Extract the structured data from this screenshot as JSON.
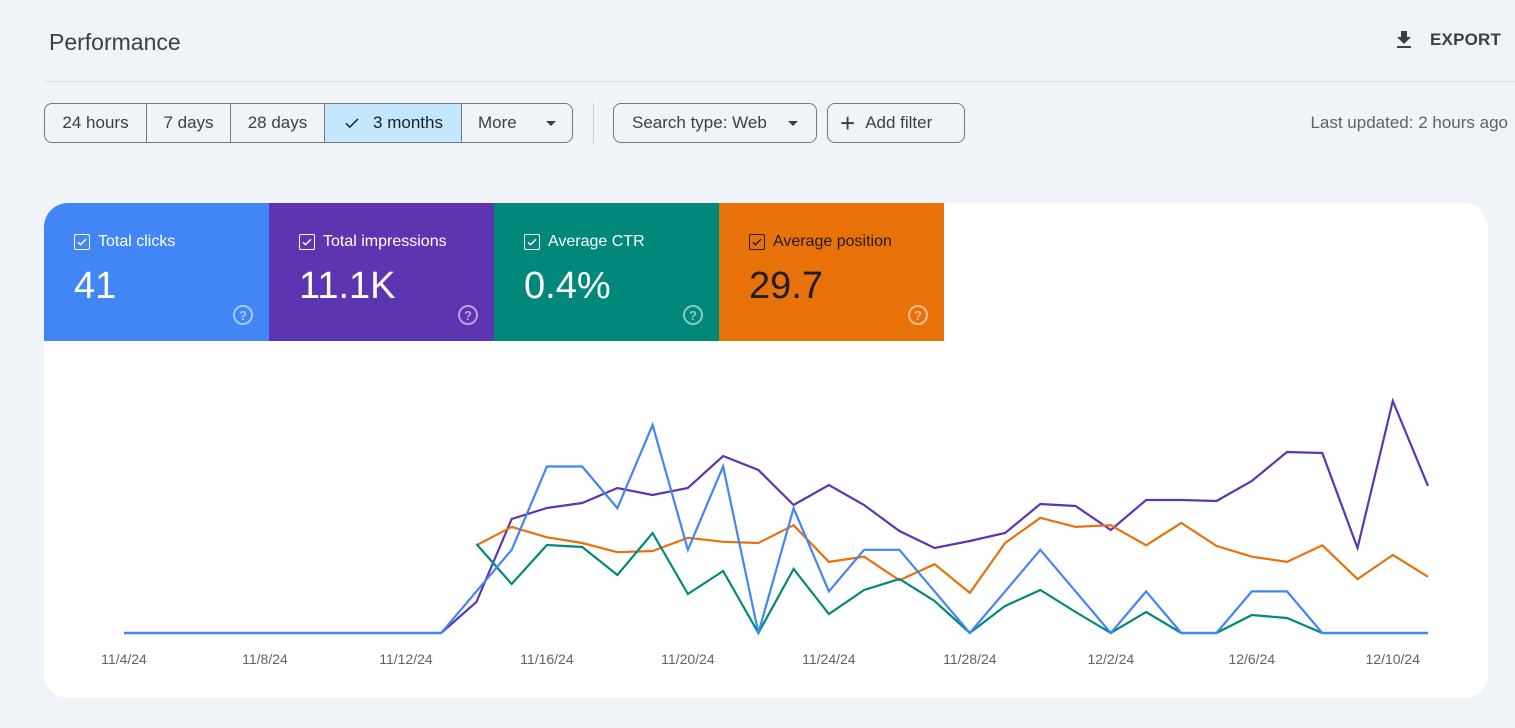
{
  "header": {
    "title": "Performance",
    "export_label": "EXPORT",
    "export_icon": "download-icon"
  },
  "filters": {
    "date_ranges": [
      {
        "label": "24 hours",
        "selected": false
      },
      {
        "label": "7 days",
        "selected": false
      },
      {
        "label": "28 days",
        "selected": false
      },
      {
        "label": "3 months",
        "selected": true
      },
      {
        "label": "More",
        "selected": false
      }
    ],
    "search_type_label": "Search type: Web",
    "add_filter_label": "Add filter",
    "last_updated": "Last updated: 2 hours ago"
  },
  "metrics": [
    {
      "label": "Total clicks",
      "value": "41",
      "checked": true,
      "color": "#4285f4"
    },
    {
      "label": "Total impressions",
      "value": "11.1K",
      "checked": true,
      "color": "#5e35b1"
    },
    {
      "label": "Average CTR",
      "value": "0.4%",
      "checked": true,
      "color": "#00897b"
    },
    {
      "label": "Average position",
      "value": "29.7",
      "checked": true,
      "color": "#e8710a"
    }
  ],
  "chart_data": {
    "type": "line",
    "title": "",
    "xlabel": "",
    "ylabel": "",
    "grid": false,
    "legend": "none",
    "x": [
      "11/4/24",
      "11/5/24",
      "11/6/24",
      "11/7/24",
      "11/8/24",
      "11/9/24",
      "11/10/24",
      "11/11/24",
      "11/12/24",
      "11/13/24",
      "11/14/24",
      "11/15/24",
      "11/16/24",
      "11/17/24",
      "11/18/24",
      "11/19/24",
      "11/20/24",
      "11/21/24",
      "11/22/24",
      "11/23/24",
      "11/24/24",
      "11/25/24",
      "11/26/24",
      "11/27/24",
      "11/28/24",
      "11/29/24",
      "11/30/24",
      "12/1/24",
      "12/2/24",
      "12/3/24",
      "12/4/24",
      "12/5/24",
      "12/6/24",
      "12/7/24",
      "12/8/24",
      "12/9/24",
      "12/10/24",
      "12/11/24"
    ],
    "x_tick_labels": [
      "11/4/24",
      "11/8/24",
      "11/12/24",
      "11/16/24",
      "11/20/24",
      "11/24/24",
      "11/28/24",
      "12/2/24",
      "12/6/24",
      "12/10/24"
    ],
    "series": [
      {
        "name": "Total clicks",
        "color": "#4285f4",
        "ylim": [
          0,
          6.2
        ],
        "inverted": false,
        "values": [
          0,
          0,
          0,
          0,
          0,
          0,
          0,
          0,
          0,
          0,
          1,
          2,
          4,
          4,
          3,
          5,
          2,
          4,
          0,
          3,
          1,
          2,
          2,
          1,
          0,
          1,
          2,
          1,
          0,
          1,
          0,
          0,
          1,
          1,
          0,
          0,
          0,
          0
        ]
      },
      {
        "name": "Total impressions",
        "color": "#5e35b1",
        "ylim": [
          0,
          774
        ],
        "inverted": false,
        "values": [
          0,
          0,
          0,
          0,
          0,
          0,
          0,
          0,
          0,
          0,
          93,
          342,
          375,
          390,
          435,
          414,
          435,
          531,
          489,
          384,
          444,
          384,
          306,
          255,
          276,
          300,
          387,
          381,
          309,
          399,
          399,
          396,
          456,
          543,
          540,
          255,
          696,
          441
        ]
      },
      {
        "name": "Average CTR",
        "color": "#00897b",
        "ylim": [
          0,
          2.58
        ],
        "inverted": false,
        "unit": "%",
        "values": [
          null,
          null,
          null,
          null,
          null,
          null,
          null,
          null,
          null,
          null,
          0.89,
          0.49,
          0.88,
          0.86,
          0.58,
          1.0,
          0.39,
          0.62,
          0,
          0.64,
          0.19,
          0.43,
          0.54,
          0.32,
          0,
          0.27,
          0.43,
          0.21,
          0,
          0.21,
          0,
          0,
          0.18,
          0.15,
          0,
          0,
          0,
          0
        ]
      },
      {
        "name": "Average position",
        "color": "#e8710a",
        "ylim": [
          0,
          45
        ],
        "inverted": true,
        "values": [
          null,
          null,
          null,
          null,
          null,
          null,
          null,
          null,
          null,
          null,
          29.7,
          26.5,
          28.3,
          29.3,
          30.9,
          30.7,
          28.4,
          29.1,
          29.3,
          26.2,
          32.6,
          31.7,
          35.8,
          33.0,
          38.0,
          29.3,
          24.9,
          26.5,
          26.2,
          29.7,
          25.8,
          29.8,
          31.7,
          32.6,
          29.7,
          35.6,
          31.4,
          35.2
        ]
      }
    ]
  }
}
